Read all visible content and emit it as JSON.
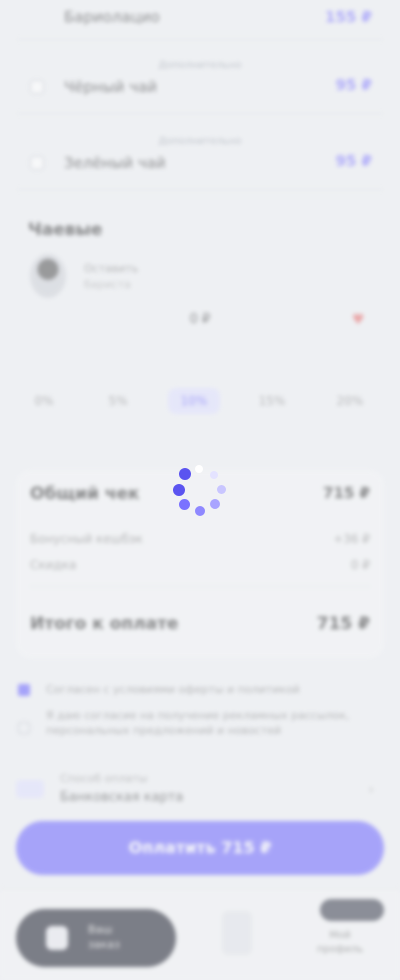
{
  "order": {
    "rows": [
      {
        "name": "Бариолацио",
        "price": "155 ₽",
        "hint": ""
      },
      {
        "name": "Чёрный чай",
        "price": "95 ₽",
        "hint": "Дополнительно"
      },
      {
        "name": "Зелёный чай",
        "price": "95 ₽",
        "hint": "Дополнительно"
      }
    ]
  },
  "tips": {
    "title": "Чаевые",
    "subtitle_1": "Оставить",
    "subtitle_2": "бариста",
    "center": "0 ₽",
    "options": [
      {
        "label": "0%",
        "selected": false
      },
      {
        "label": "5%",
        "selected": false
      },
      {
        "label": "10%",
        "selected": true
      },
      {
        "label": "15%",
        "selected": false
      },
      {
        "label": "20%",
        "selected": false
      }
    ]
  },
  "summary": {
    "title": "Общий чек",
    "title_value": "715 ₽",
    "rows": [
      {
        "label": "Бонусный кешбэк",
        "value": "+36 ₽"
      },
      {
        "label": "Скидка",
        "value": "0 ₽"
      }
    ],
    "total_label": "Итого к оплате",
    "total_value": "715 ₽"
  },
  "agreements": [
    {
      "text": "Согласен с условиями оферты и политикой",
      "checked": true
    },
    {
      "text": "Я даю согласие на получение рекламных рассылок, персональных предложений и новостей",
      "checked": false
    }
  ],
  "payment": {
    "label": "Способ оплаты",
    "value": "Банковская карта"
  },
  "pay_button": {
    "label": "Оплатить 715 ₽"
  },
  "bottom_bar": {
    "pill_text_1": "Ваш",
    "pill_text_2": "заказ",
    "right_text_1": "Мой",
    "right_text_2": "профиль"
  },
  "colors": {
    "accent": "#6d66ff",
    "spinner_dark": "#5b54f0",
    "spinner_light": "#c9c6ff"
  },
  "loading": true
}
